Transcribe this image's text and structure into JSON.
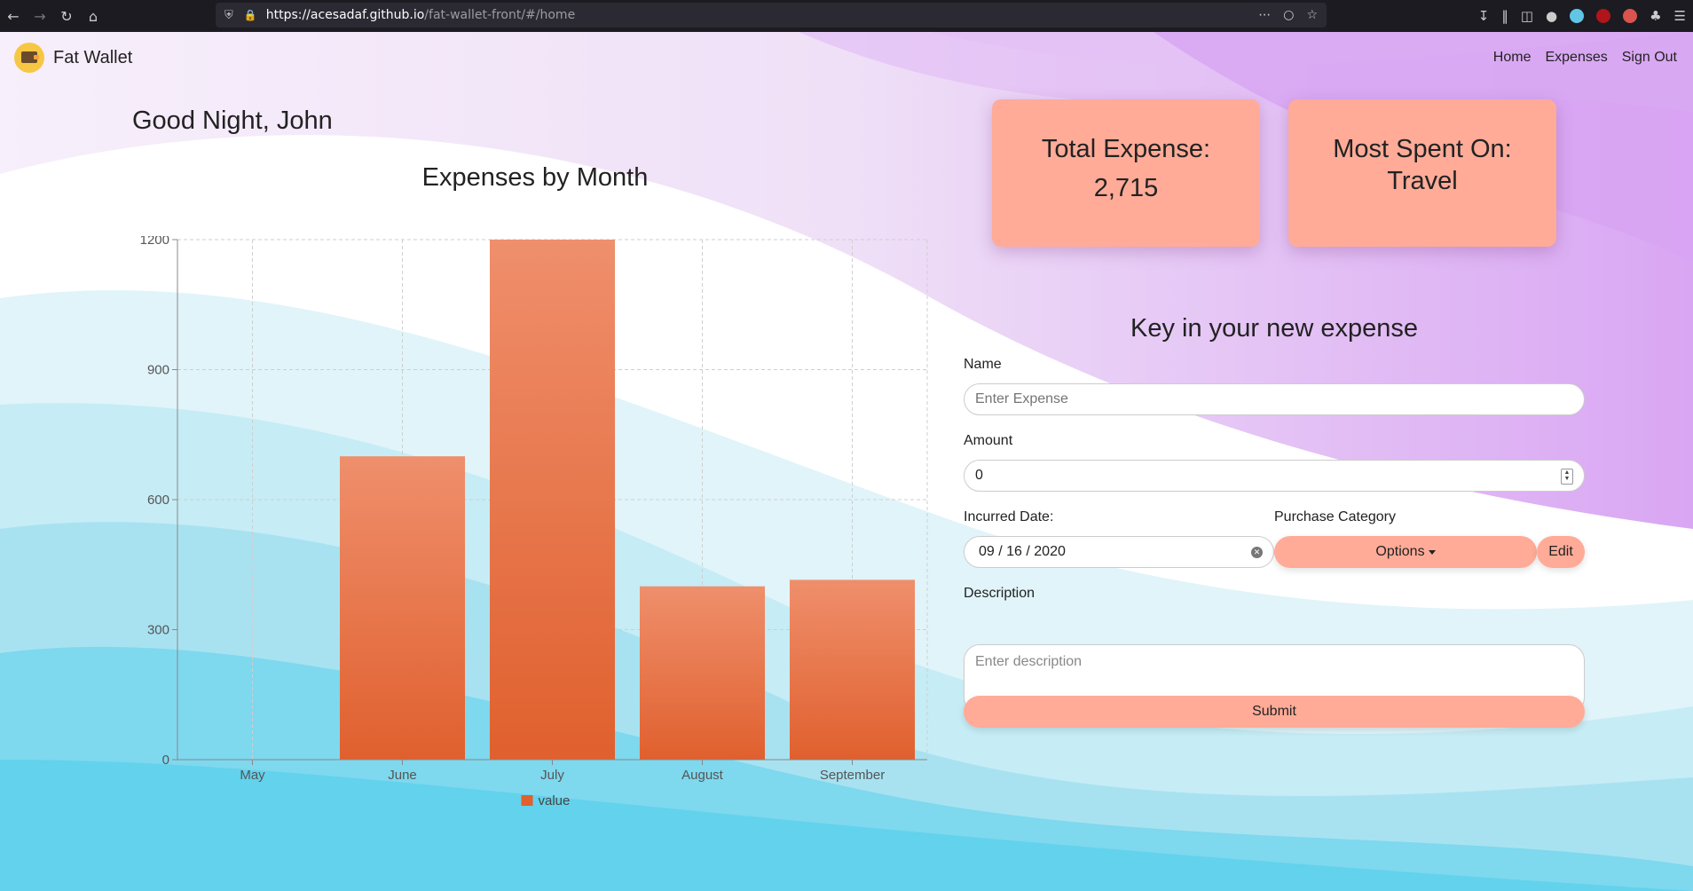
{
  "browser": {
    "url_host": "https://acesadaf.github.io",
    "url_path": "/fat-wallet-front/#/home"
  },
  "app": {
    "name": "Fat Wallet"
  },
  "nav": {
    "home": "Home",
    "expenses": "Expenses",
    "sign_out": "Sign Out"
  },
  "greeting": "Good Night, John",
  "chart_title": "Expenses by Month",
  "cards": {
    "total_label": "Total Expense:",
    "total_value": "2,715",
    "most_label": "Most Spent On:",
    "most_value": "Travel"
  },
  "form": {
    "title": "Key in your new expense",
    "name_label": "Name",
    "name_placeholder": "Enter Expense",
    "amount_label": "Amount",
    "amount_value": "0",
    "date_label": "Incurred Date:",
    "date_value": "09 / 16 / 2020",
    "category_label": "Purchase Category",
    "options_label": "Options",
    "edit_label": "Edit",
    "description_label": "Description",
    "description_placeholder": "Enter description",
    "submit_label": "Submit"
  },
  "colors": {
    "accent": "#ffab98",
    "bar_top": "#ef8f6c",
    "bar_bottom": "#e0602e"
  },
  "chart_data": {
    "type": "bar",
    "categories": [
      "May",
      "June",
      "July",
      "August",
      "September"
    ],
    "series": [
      {
        "name": "value",
        "values": [
          0,
          700,
          1200,
          400,
          415
        ]
      }
    ],
    "ylim": [
      0,
      1200
    ],
    "yticks": [
      0,
      300,
      600,
      900,
      1200
    ],
    "grid": true,
    "legend": "bottom-center"
  }
}
